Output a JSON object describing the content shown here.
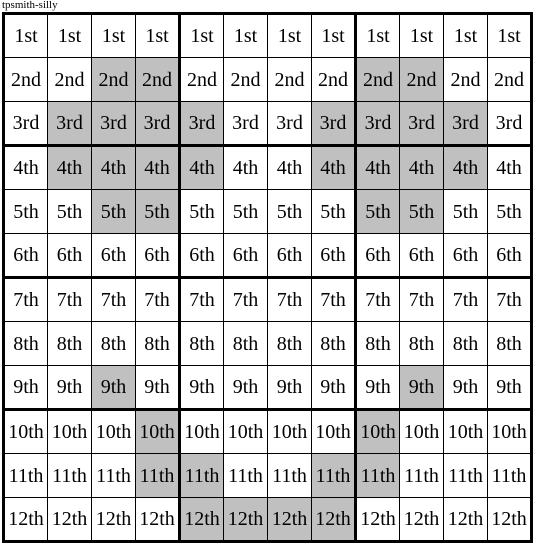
{
  "title": "tpsmith-silly",
  "colors": {
    "shaded_cell": "#c0c0c0",
    "plain_cell": "#ffffff",
    "border": "#000000",
    "text": "#000000"
  },
  "grid": {
    "rows": 12,
    "columns": 12,
    "column_group_size": 4,
    "row_group_size": 3,
    "row_labels": [
      "1st",
      "2nd",
      "3rd",
      "4th",
      "5th",
      "6th",
      "7th",
      "8th",
      "9th",
      "10th",
      "11th",
      "12th"
    ],
    "cells": [
      [
        {
          "label": "1st",
          "shaded": false
        },
        {
          "label": "1st",
          "shaded": false
        },
        {
          "label": "1st",
          "shaded": false
        },
        {
          "label": "1st",
          "shaded": false
        },
        {
          "label": "1st",
          "shaded": false
        },
        {
          "label": "1st",
          "shaded": false
        },
        {
          "label": "1st",
          "shaded": false
        },
        {
          "label": "1st",
          "shaded": false
        },
        {
          "label": "1st",
          "shaded": false
        },
        {
          "label": "1st",
          "shaded": false
        },
        {
          "label": "1st",
          "shaded": false
        },
        {
          "label": "1st",
          "shaded": false
        }
      ],
      [
        {
          "label": "2nd",
          "shaded": false
        },
        {
          "label": "2nd",
          "shaded": false
        },
        {
          "label": "2nd",
          "shaded": true
        },
        {
          "label": "2nd",
          "shaded": true
        },
        {
          "label": "2nd",
          "shaded": false
        },
        {
          "label": "2nd",
          "shaded": false
        },
        {
          "label": "2nd",
          "shaded": false
        },
        {
          "label": "2nd",
          "shaded": false
        },
        {
          "label": "2nd",
          "shaded": true
        },
        {
          "label": "2nd",
          "shaded": true
        },
        {
          "label": "2nd",
          "shaded": false
        },
        {
          "label": "2nd",
          "shaded": false
        }
      ],
      [
        {
          "label": "3rd",
          "shaded": false
        },
        {
          "label": "3rd",
          "shaded": true
        },
        {
          "label": "3rd",
          "shaded": true
        },
        {
          "label": "3rd",
          "shaded": true
        },
        {
          "label": "3rd",
          "shaded": true
        },
        {
          "label": "3rd",
          "shaded": false
        },
        {
          "label": "3rd",
          "shaded": false
        },
        {
          "label": "3rd",
          "shaded": true
        },
        {
          "label": "3rd",
          "shaded": true
        },
        {
          "label": "3rd",
          "shaded": true
        },
        {
          "label": "3rd",
          "shaded": true
        },
        {
          "label": "3rd",
          "shaded": false
        }
      ],
      [
        {
          "label": "4th",
          "shaded": false
        },
        {
          "label": "4th",
          "shaded": true
        },
        {
          "label": "4th",
          "shaded": true
        },
        {
          "label": "4th",
          "shaded": true
        },
        {
          "label": "4th",
          "shaded": true
        },
        {
          "label": "4th",
          "shaded": false
        },
        {
          "label": "4th",
          "shaded": false
        },
        {
          "label": "4th",
          "shaded": true
        },
        {
          "label": "4th",
          "shaded": true
        },
        {
          "label": "4th",
          "shaded": true
        },
        {
          "label": "4th",
          "shaded": true
        },
        {
          "label": "4th",
          "shaded": false
        }
      ],
      [
        {
          "label": "5th",
          "shaded": false
        },
        {
          "label": "5th",
          "shaded": false
        },
        {
          "label": "5th",
          "shaded": true
        },
        {
          "label": "5th",
          "shaded": true
        },
        {
          "label": "5th",
          "shaded": false
        },
        {
          "label": "5th",
          "shaded": false
        },
        {
          "label": "5th",
          "shaded": false
        },
        {
          "label": "5th",
          "shaded": false
        },
        {
          "label": "5th",
          "shaded": true
        },
        {
          "label": "5th",
          "shaded": true
        },
        {
          "label": "5th",
          "shaded": false
        },
        {
          "label": "5th",
          "shaded": false
        }
      ],
      [
        {
          "label": "6th",
          "shaded": false
        },
        {
          "label": "6th",
          "shaded": false
        },
        {
          "label": "6th",
          "shaded": false
        },
        {
          "label": "6th",
          "shaded": false
        },
        {
          "label": "6th",
          "shaded": false
        },
        {
          "label": "6th",
          "shaded": false
        },
        {
          "label": "6th",
          "shaded": false
        },
        {
          "label": "6th",
          "shaded": false
        },
        {
          "label": "6th",
          "shaded": false
        },
        {
          "label": "6th",
          "shaded": false
        },
        {
          "label": "6th",
          "shaded": false
        },
        {
          "label": "6th",
          "shaded": false
        }
      ],
      [
        {
          "label": "7th",
          "shaded": false
        },
        {
          "label": "7th",
          "shaded": false
        },
        {
          "label": "7th",
          "shaded": false
        },
        {
          "label": "7th",
          "shaded": false
        },
        {
          "label": "7th",
          "shaded": false
        },
        {
          "label": "7th",
          "shaded": false
        },
        {
          "label": "7th",
          "shaded": false
        },
        {
          "label": "7th",
          "shaded": false
        },
        {
          "label": "7th",
          "shaded": false
        },
        {
          "label": "7th",
          "shaded": false
        },
        {
          "label": "7th",
          "shaded": false
        },
        {
          "label": "7th",
          "shaded": false
        }
      ],
      [
        {
          "label": "8th",
          "shaded": false
        },
        {
          "label": "8th",
          "shaded": false
        },
        {
          "label": "8th",
          "shaded": false
        },
        {
          "label": "8th",
          "shaded": false
        },
        {
          "label": "8th",
          "shaded": false
        },
        {
          "label": "8th",
          "shaded": false
        },
        {
          "label": "8th",
          "shaded": false
        },
        {
          "label": "8th",
          "shaded": false
        },
        {
          "label": "8th",
          "shaded": false
        },
        {
          "label": "8th",
          "shaded": false
        },
        {
          "label": "8th",
          "shaded": false
        },
        {
          "label": "8th",
          "shaded": false
        }
      ],
      [
        {
          "label": "9th",
          "shaded": false
        },
        {
          "label": "9th",
          "shaded": false
        },
        {
          "label": "9th",
          "shaded": true
        },
        {
          "label": "9th",
          "shaded": false
        },
        {
          "label": "9th",
          "shaded": false
        },
        {
          "label": "9th",
          "shaded": false
        },
        {
          "label": "9th",
          "shaded": false
        },
        {
          "label": "9th",
          "shaded": false
        },
        {
          "label": "9th",
          "shaded": false
        },
        {
          "label": "9th",
          "shaded": true
        },
        {
          "label": "9th",
          "shaded": false
        },
        {
          "label": "9th",
          "shaded": false
        }
      ],
      [
        {
          "label": "10th",
          "shaded": false
        },
        {
          "label": "10th",
          "shaded": false
        },
        {
          "label": "10th",
          "shaded": false
        },
        {
          "label": "10th",
          "shaded": true
        },
        {
          "label": "10th",
          "shaded": false
        },
        {
          "label": "10th",
          "shaded": false
        },
        {
          "label": "10th",
          "shaded": false
        },
        {
          "label": "10th",
          "shaded": false
        },
        {
          "label": "10th",
          "shaded": true
        },
        {
          "label": "10th",
          "shaded": false
        },
        {
          "label": "10th",
          "shaded": false
        },
        {
          "label": "10th",
          "shaded": false
        }
      ],
      [
        {
          "label": "11th",
          "shaded": false
        },
        {
          "label": "11th",
          "shaded": false
        },
        {
          "label": "11th",
          "shaded": false
        },
        {
          "label": "11th",
          "shaded": true
        },
        {
          "label": "11th",
          "shaded": true
        },
        {
          "label": "11th",
          "shaded": false
        },
        {
          "label": "11th",
          "shaded": false
        },
        {
          "label": "11th",
          "shaded": true
        },
        {
          "label": "11th",
          "shaded": true
        },
        {
          "label": "11th",
          "shaded": false
        },
        {
          "label": "11th",
          "shaded": false
        },
        {
          "label": "11th",
          "shaded": false
        }
      ],
      [
        {
          "label": "12th",
          "shaded": false
        },
        {
          "label": "12th",
          "shaded": false
        },
        {
          "label": "12th",
          "shaded": false
        },
        {
          "label": "12th",
          "shaded": false
        },
        {
          "label": "12th",
          "shaded": true
        },
        {
          "label": "12th",
          "shaded": true
        },
        {
          "label": "12th",
          "shaded": true
        },
        {
          "label": "12th",
          "shaded": true
        },
        {
          "label": "12th",
          "shaded": false
        },
        {
          "label": "12th",
          "shaded": false
        },
        {
          "label": "12th",
          "shaded": false
        },
        {
          "label": "12th",
          "shaded": false
        }
      ]
    ]
  }
}
